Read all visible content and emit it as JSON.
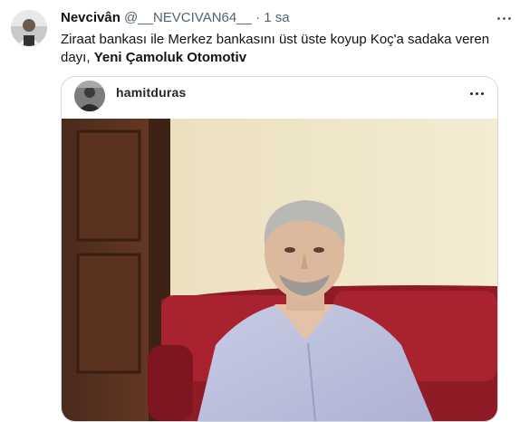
{
  "tweet": {
    "author_name": "Nevcivân",
    "handle": "@__NEVCIVAN64__",
    "separator": "·",
    "time": "1 sa",
    "text_plain": "Ziraat bankası ile Merkez bankasını üst üste koyup Koç'a sadaka veren dayı,",
    "text_bold": "Yeni Çamoluk Otomotiv"
  },
  "embedded_post": {
    "username": "hamitduras"
  },
  "icons": {
    "more": "more-horizontal-icon",
    "more_inner": "more-horizontal-icon"
  },
  "colors": {
    "text": "#0f1419",
    "muted": "#536471",
    "border": "#cfd9de",
    "sofa_red": "#9b1f2a",
    "wall": "#efe6c9"
  }
}
